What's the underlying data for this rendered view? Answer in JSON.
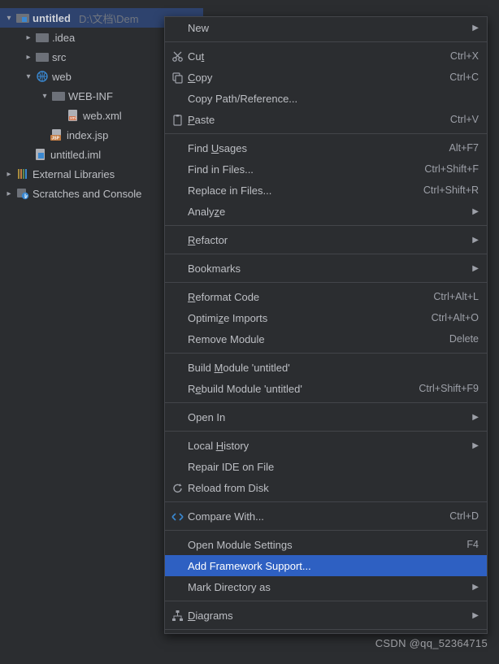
{
  "project": {
    "root_name": "untitled",
    "root_path": "D:\\文档\\Dem",
    "nodes": {
      "idea": ".idea",
      "src": "src",
      "web": "web",
      "webinf": "WEB-INF",
      "webxml": "web.xml",
      "indexjsp": "index.jsp",
      "iml": "untitled.iml",
      "ext": "External Libraries",
      "scratch": "Scratches and Console"
    }
  },
  "menu": {
    "items": [
      {
        "label": "New",
        "sub": true
      },
      {
        "sep": true
      },
      {
        "label": "Cut",
        "mn": "t",
        "short": "Ctrl+X",
        "icon": "cut"
      },
      {
        "label": "Copy",
        "mn": "C",
        "short": "Ctrl+C",
        "icon": "copy"
      },
      {
        "label": "Copy Path/Reference..."
      },
      {
        "label": "Paste",
        "mn": "P",
        "short": "Ctrl+V",
        "icon": "paste"
      },
      {
        "sep": true
      },
      {
        "label": "Find Usages",
        "mn": "U",
        "short": "Alt+F7"
      },
      {
        "label": "Find in Files...",
        "short": "Ctrl+Shift+F"
      },
      {
        "label": "Replace in Files...",
        "short": "Ctrl+Shift+R"
      },
      {
        "label": "Analyze",
        "mn": "z",
        "sub": true
      },
      {
        "sep": true
      },
      {
        "label": "Refactor",
        "mn": "R",
        "sub": true
      },
      {
        "sep": true
      },
      {
        "label": "Bookmarks",
        "sub": true
      },
      {
        "sep": true
      },
      {
        "label": "Reformat Code",
        "mn": "R",
        "short": "Ctrl+Alt+L"
      },
      {
        "label": "Optimize Imports",
        "mn": "z",
        "short": "Ctrl+Alt+O"
      },
      {
        "label": "Remove Module",
        "short": "Delete"
      },
      {
        "sep": true
      },
      {
        "label": "Build Module 'untitled'",
        "mn": "M"
      },
      {
        "label": "Rebuild Module 'untitled'",
        "mn": "e",
        "short": "Ctrl+Shift+F9"
      },
      {
        "sep": true
      },
      {
        "label": "Open In",
        "sub": true
      },
      {
        "sep": true
      },
      {
        "label": "Local History",
        "mn": "H",
        "sub": true
      },
      {
        "label": "Repair IDE on File"
      },
      {
        "label": "Reload from Disk",
        "icon": "reload"
      },
      {
        "sep": true
      },
      {
        "label": "Compare With...",
        "short": "Ctrl+D",
        "icon": "compare"
      },
      {
        "sep": true
      },
      {
        "label": "Open Module Settings",
        "short": "F4"
      },
      {
        "label": "Add Framework Support...",
        "highlight": true
      },
      {
        "label": "Mark Directory as",
        "sub": true
      },
      {
        "sep": true
      },
      {
        "label": "Diagrams",
        "mn": "D",
        "sub": true,
        "icon": "diagram"
      },
      {
        "sep": true
      }
    ]
  },
  "watermark": "CSDN @qq_52364715"
}
